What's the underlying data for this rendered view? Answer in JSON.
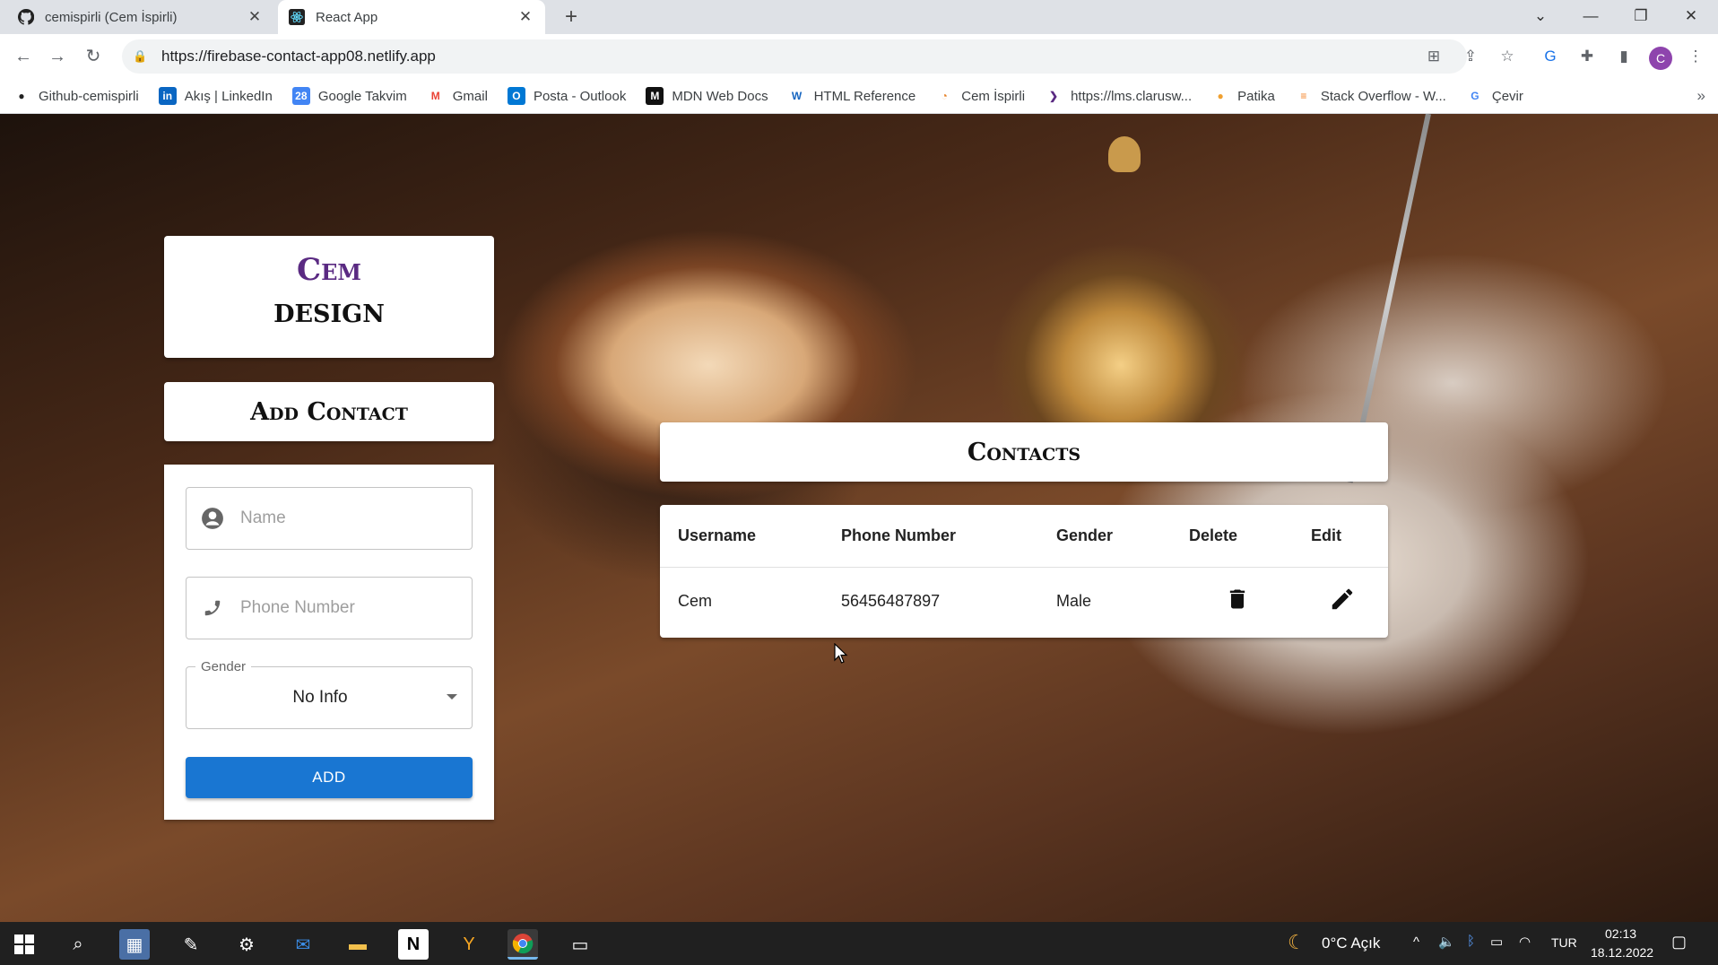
{
  "browser": {
    "tabs": [
      {
        "title": "cemispirli (Cem İspirli)",
        "favicon": "github-icon"
      },
      {
        "title": "React App",
        "favicon": "react-icon"
      }
    ],
    "url": "https://firebase-contact-app08.netlify.app",
    "profile_initial": "C",
    "bookmarks": [
      {
        "label": "Github-cemispirli",
        "icon": "github-icon"
      },
      {
        "label": "Akış | LinkedIn",
        "icon": "linkedin-icon"
      },
      {
        "label": "Google Takvim",
        "icon": "calendar-icon"
      },
      {
        "label": "Gmail",
        "icon": "gmail-icon"
      },
      {
        "label": "Posta - Outlook",
        "icon": "outlook-icon"
      },
      {
        "label": "MDN Web Docs",
        "icon": "mdn-icon"
      },
      {
        "label": "HTML Reference",
        "icon": "w3-icon"
      },
      {
        "label": "Cem İspirli",
        "icon": "portfolio-icon"
      },
      {
        "label": "https://lms.clarusw...",
        "icon": "clarusway-icon"
      },
      {
        "label": "Patika",
        "icon": "patika-icon"
      },
      {
        "label": "Stack Overflow - W...",
        "icon": "stackoverflow-icon"
      },
      {
        "label": "Çevir",
        "icon": "translate-icon"
      }
    ]
  },
  "app": {
    "brand_line1": "Cem",
    "brand_line2": "DESIGN",
    "add_contact_title": "Add Contact",
    "form": {
      "name_placeholder": "Name",
      "phone_placeholder": "Phone Number",
      "gender_label": "Gender",
      "gender_value": "No Info",
      "add_button": "ADD"
    },
    "contacts_title": "Contacts",
    "table": {
      "headers": [
        "Username",
        "Phone Number",
        "Gender",
        "Delete",
        "Edit"
      ],
      "rows": [
        {
          "username": "Cem",
          "phone": "56456487897",
          "gender": "Male"
        }
      ]
    },
    "colors": {
      "brand": "#5a2a82",
      "button": "#1976d2"
    }
  },
  "taskbar": {
    "weather": "0°C  Açık",
    "language": "TUR",
    "time": "02:13",
    "date": "18.12.2022"
  }
}
